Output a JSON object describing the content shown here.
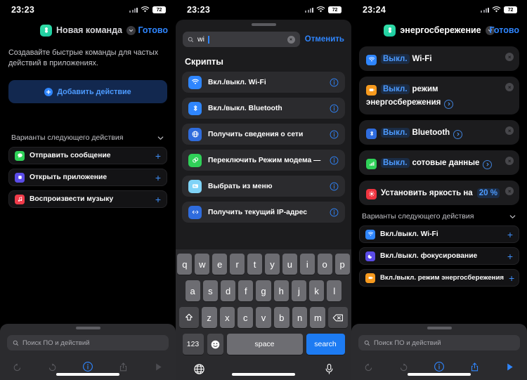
{
  "panels": [
    {
      "id": "new-shortcut",
      "status": {
        "time": "23:23",
        "battery": "72"
      },
      "nav": {
        "title": "Новая команда",
        "done": "Готово",
        "chevron_icon": "chevron-down-icon",
        "app_icon": "shortcuts-app-icon"
      },
      "description": "Создавайте быстрые команды для частых действий в приложениях.",
      "add_action": {
        "label": "Добавить действие",
        "icon": "plus-circle-icon"
      },
      "suggestions": {
        "title": "Варианты следующего действия",
        "collapse_icon": "chevron-down-icon",
        "items": [
          {
            "label": "Отправить сообщение",
            "icon": "messages-icon",
            "color": "#2fd158",
            "add_icon": "plus-icon"
          },
          {
            "label": "Открыть приложение",
            "icon": "app-open-icon",
            "color": "#5b4ce8",
            "add_icon": "plus-icon"
          },
          {
            "label": "Воспроизвести музыку",
            "icon": "music-note-icon",
            "color": "#f03b4a",
            "add_icon": "plus-icon"
          }
        ]
      },
      "search": {
        "placeholder": "Поиск ПО и действий",
        "icon": "search-icon"
      },
      "toolbar": [
        {
          "name": "undo-icon",
          "state": "disabled"
        },
        {
          "name": "redo-icon",
          "state": "disabled"
        },
        {
          "name": "info-icon",
          "state": "active"
        },
        {
          "name": "share-icon",
          "state": "disabled"
        },
        {
          "name": "play-icon",
          "state": "disabled"
        }
      ]
    },
    {
      "id": "action-search",
      "status": {
        "time": "23:23",
        "battery": "72"
      },
      "search": {
        "value": "wi",
        "icon": "search-icon",
        "clear_icon": "clear-circle-icon",
        "cancel": "Отменить"
      },
      "section_title": "Скрипты",
      "results": [
        {
          "label": "Вкл./выкл. Wi-Fi",
          "icon": "wifi-icon",
          "color": "#2f86ff",
          "info_icon": "info-icon"
        },
        {
          "label": "Вкл./выкл. Bluetooth",
          "icon": "bluetooth-icon",
          "color": "#2f86ff",
          "info_icon": "info-icon"
        },
        {
          "label": "Получить сведения о сети",
          "icon": "globe-icon",
          "color": "#2f6cdd",
          "info_icon": "info-icon"
        },
        {
          "label": "Переключить Режим модема —",
          "icon": "hotspot-icon",
          "color": "#2fd158",
          "info_icon": "info-icon"
        },
        {
          "label": "Выбрать из меню",
          "icon": "menu-card-icon",
          "color": "#7fd3f7",
          "info_icon": "info-icon"
        },
        {
          "label": "Получить текущий IP-адрес",
          "icon": "ip-address-icon",
          "color": "#2f6cdd",
          "info_icon": "info-icon"
        }
      ],
      "keyboard": {
        "row1": [
          "q",
          "w",
          "e",
          "r",
          "t",
          "y",
          "u",
          "i",
          "o",
          "p"
        ],
        "row2": [
          "a",
          "s",
          "d",
          "f",
          "g",
          "h",
          "j",
          "k",
          "l"
        ],
        "row3": [
          "z",
          "x",
          "c",
          "v",
          "b",
          "n",
          "m"
        ],
        "shift_icon": "shift-icon",
        "backspace_icon": "backspace-icon",
        "numbers_key": "123",
        "emoji_icon": "emoji-icon",
        "space_key": "space",
        "search_key": "search",
        "globe_icon": "globe-key-icon",
        "mic_icon": "microphone-icon"
      }
    },
    {
      "id": "energy-saving-shortcut",
      "status": {
        "time": "23:24",
        "battery": "72"
      },
      "nav": {
        "title": "энергосбережение",
        "done": "Готово",
        "chevron_icon": "chevron-down-icon",
        "app_icon": "shortcuts-app-icon"
      },
      "actions": [
        {
          "toggle": "Выкл.",
          "target": "Wi-Fi",
          "icon": "wifi-icon",
          "color": "#2f86ff",
          "has_arrow": false,
          "remove_icon": "remove-circle-icon"
        },
        {
          "toggle": "Выкл.",
          "target": "режим энергосбережения",
          "icon": "low-power-icon",
          "color": "#f79a1e",
          "has_arrow": true,
          "remove_icon": "remove-circle-icon"
        },
        {
          "toggle": "Выкл.",
          "target": "Bluetooth",
          "icon": "bluetooth-icon",
          "color": "#2f86ff",
          "has_arrow": true,
          "remove_icon": "remove-circle-icon"
        },
        {
          "toggle": "Выкл.",
          "target": "сотовые данные",
          "icon": "cellular-icon",
          "color": "#2fd158",
          "has_arrow": true,
          "remove_icon": "remove-circle-icon"
        },
        {
          "toggle": "Установить яркость на",
          "target": "20 %",
          "icon": "brightness-icon",
          "color": "#f0343f",
          "has_arrow": false,
          "remove_icon": "remove-circle-icon",
          "style": "brightness"
        }
      ],
      "suggestions": {
        "title": "Варианты следующего действия",
        "collapse_icon": "chevron-down-icon",
        "items": [
          {
            "label": "Вкл./выкл. Wi-Fi",
            "icon": "wifi-icon",
            "color": "#2f86ff",
            "add_icon": "plus-icon"
          },
          {
            "label": "Вкл./выкл. фокусирование",
            "icon": "focus-icon",
            "color": "#5b4ce8",
            "add_icon": "plus-icon"
          },
          {
            "label": "Вкл./выкл. режим энергосбережения",
            "icon": "low-power-icon",
            "color": "#f79a1e",
            "add_icon": "plus-icon"
          }
        ]
      },
      "search": {
        "placeholder": "Поиск ПО и действий",
        "icon": "search-icon"
      },
      "toolbar": [
        {
          "name": "undo-icon",
          "state": "disabled"
        },
        {
          "name": "redo-icon",
          "state": "disabled"
        },
        {
          "name": "info-icon",
          "state": "active"
        },
        {
          "name": "share-icon",
          "state": "active"
        },
        {
          "name": "play-icon",
          "state": "active"
        }
      ]
    }
  ],
  "colors": {
    "accent_blue": "#2f86ff",
    "link_blue": "#4d9bff",
    "card_bg": "#1c1c1e",
    "sheet_bg": "#2b2b2e",
    "background": "#000000"
  }
}
